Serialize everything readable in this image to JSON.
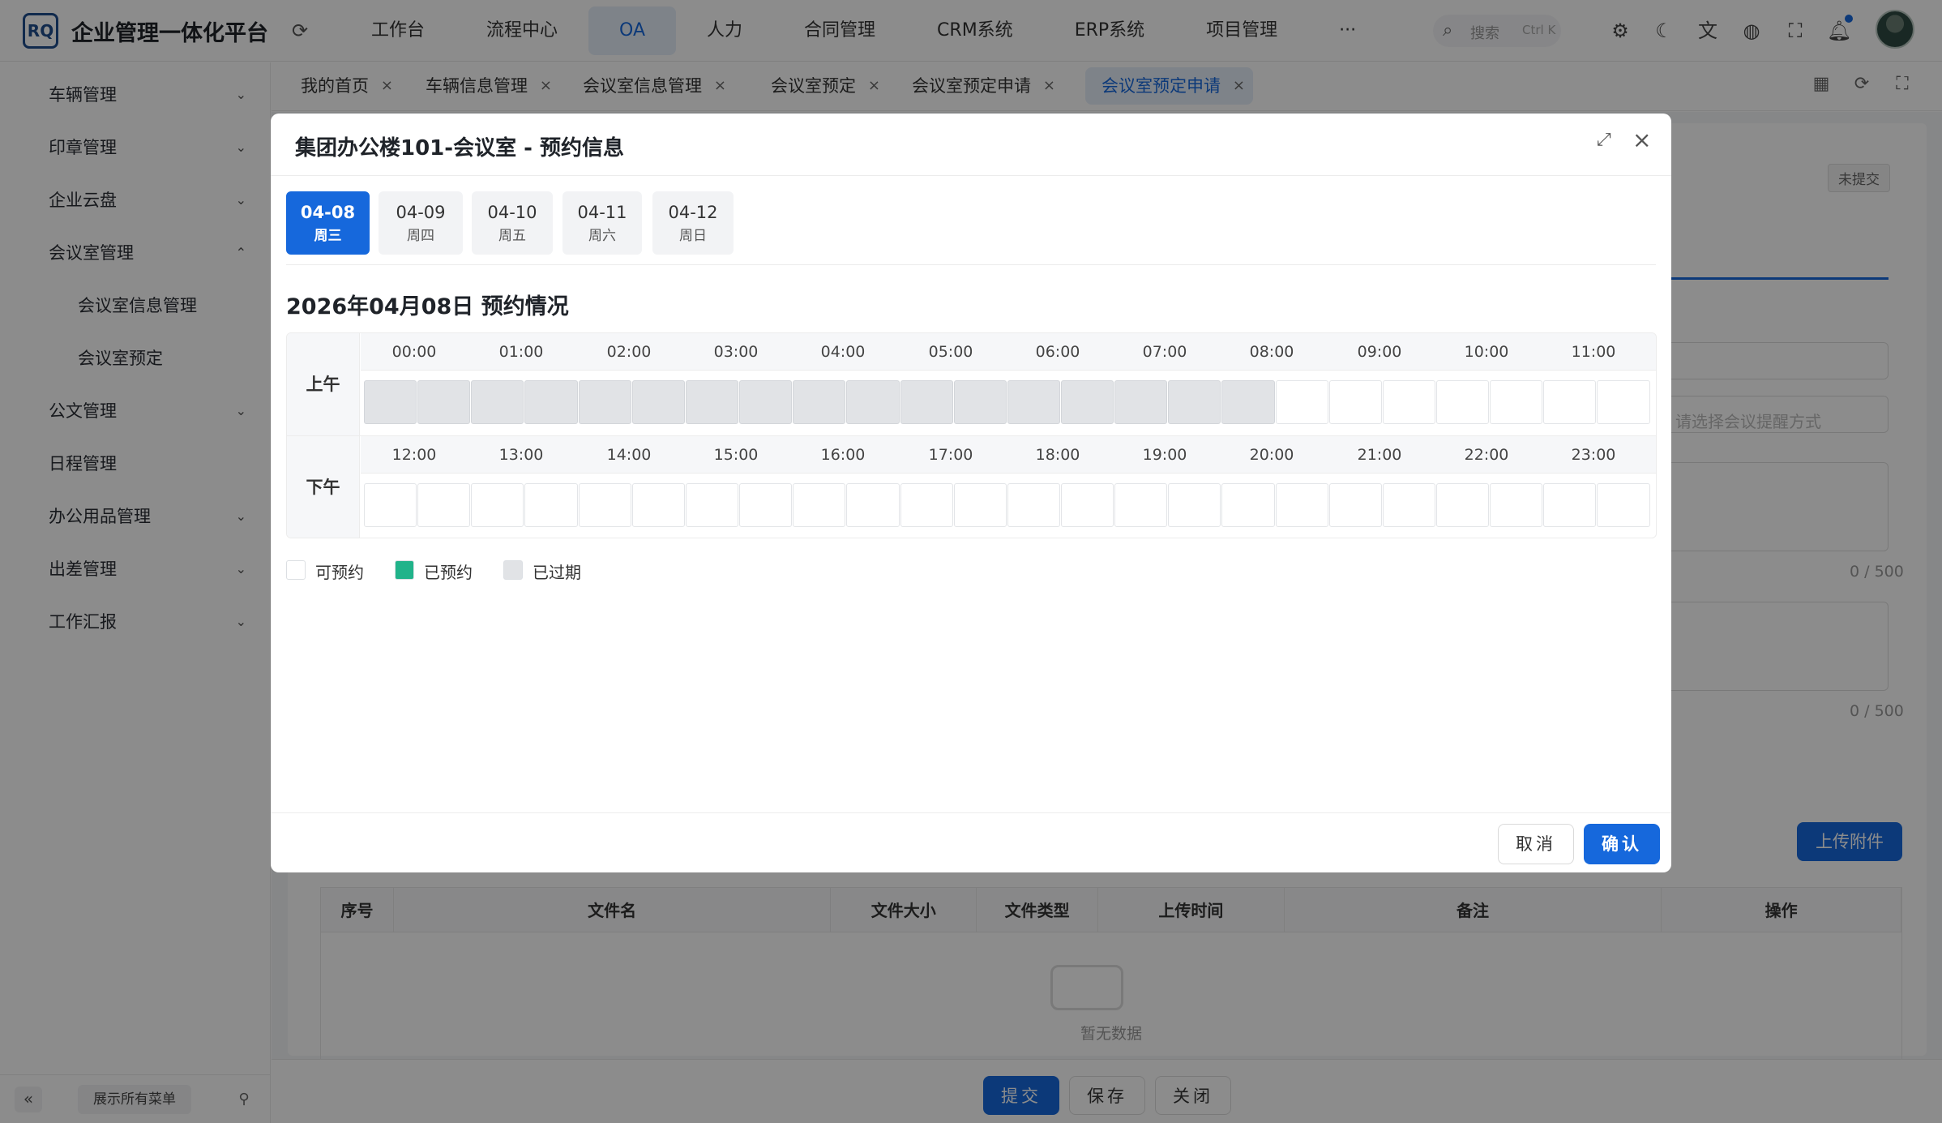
{
  "header": {
    "logo_text": "RQ",
    "app_title": "企业管理一体化平台",
    "nav": [
      "工作台",
      "流程中心",
      "OA",
      "人力",
      "合同管理",
      "CRM系统",
      "ERP系统",
      "项目管理",
      "···"
    ],
    "active_nav": "OA",
    "search_placeholder": "搜索",
    "search_shortcut": "Ctrl K"
  },
  "sidebar": {
    "items": [
      {
        "label": "车辆管理",
        "chevron": "⌄"
      },
      {
        "label": "印章管理",
        "chevron": "⌄"
      },
      {
        "label": "企业云盘",
        "chevron": "⌄"
      },
      {
        "label": "会议室管理",
        "chevron": "⌃"
      },
      {
        "label": "会议室信息管理",
        "chevron": ""
      },
      {
        "label": "会议室预定",
        "chevron": ""
      },
      {
        "label": "公文管理",
        "chevron": "⌄"
      },
      {
        "label": "日程管理",
        "chevron": ""
      },
      {
        "label": "办公用品管理",
        "chevron": "⌄"
      },
      {
        "label": "出差管理",
        "chevron": "⌄"
      },
      {
        "label": "工作汇报",
        "chevron": "⌄"
      }
    ],
    "expand_all": "展示所有菜单"
  },
  "tabs": [
    {
      "label": "我的首页"
    },
    {
      "label": "车辆信息管理"
    },
    {
      "label": "会议室信息管理"
    },
    {
      "label": "会议室预定"
    },
    {
      "label": "会议室预定申请"
    },
    {
      "label": "会议室预定申请"
    }
  ],
  "background": {
    "status": "未提交",
    "select_placeholder": "请选择会议提醒方式",
    "count_1": "0 / 500",
    "count_2": "0 / 500",
    "upload_button": "上传附件",
    "table_columns": [
      "序号",
      "文件名",
      "文件大小",
      "文件类型",
      "上传时间",
      "备注",
      "操作"
    ],
    "empty_text": "暂无数据",
    "footer_buttons": [
      "提交",
      "保存",
      "关闭"
    ]
  },
  "modal": {
    "title": "集团办公楼101-会议室 - 预约信息",
    "days": [
      {
        "date": "04-08",
        "weekday": "周三",
        "active": true
      },
      {
        "date": "04-09",
        "weekday": "周四",
        "active": false
      },
      {
        "date": "04-10",
        "weekday": "周五",
        "active": false
      },
      {
        "date": "04-11",
        "weekday": "周六",
        "active": false
      },
      {
        "date": "04-12",
        "weekday": "周日",
        "active": false
      }
    ],
    "heading": "2026年04月08日 预约情况",
    "am_label": "上午",
    "pm_label": "下午",
    "am_hours": [
      "00:00",
      "01:00",
      "02:00",
      "03:00",
      "04:00",
      "05:00",
      "06:00",
      "07:00",
      "08:00",
      "09:00",
      "10:00",
      "11:00"
    ],
    "pm_hours": [
      "12:00",
      "13:00",
      "14:00",
      "15:00",
      "16:00",
      "17:00",
      "18:00",
      "19:00",
      "20:00",
      "21:00",
      "22:00",
      "23:00"
    ],
    "expired_half_hour_slots": 17,
    "legend": [
      {
        "label": "可预约",
        "color": "#ffffff"
      },
      {
        "label": "已预约",
        "color": "#21b38a"
      },
      {
        "label": "已过期",
        "color": "#e1e3e6"
      }
    ],
    "cancel_label": "取消",
    "confirm_label": "确认"
  },
  "colors": {
    "primary": "#1668dc",
    "booked": "#21b38a",
    "expired": "#e1e3e6"
  }
}
